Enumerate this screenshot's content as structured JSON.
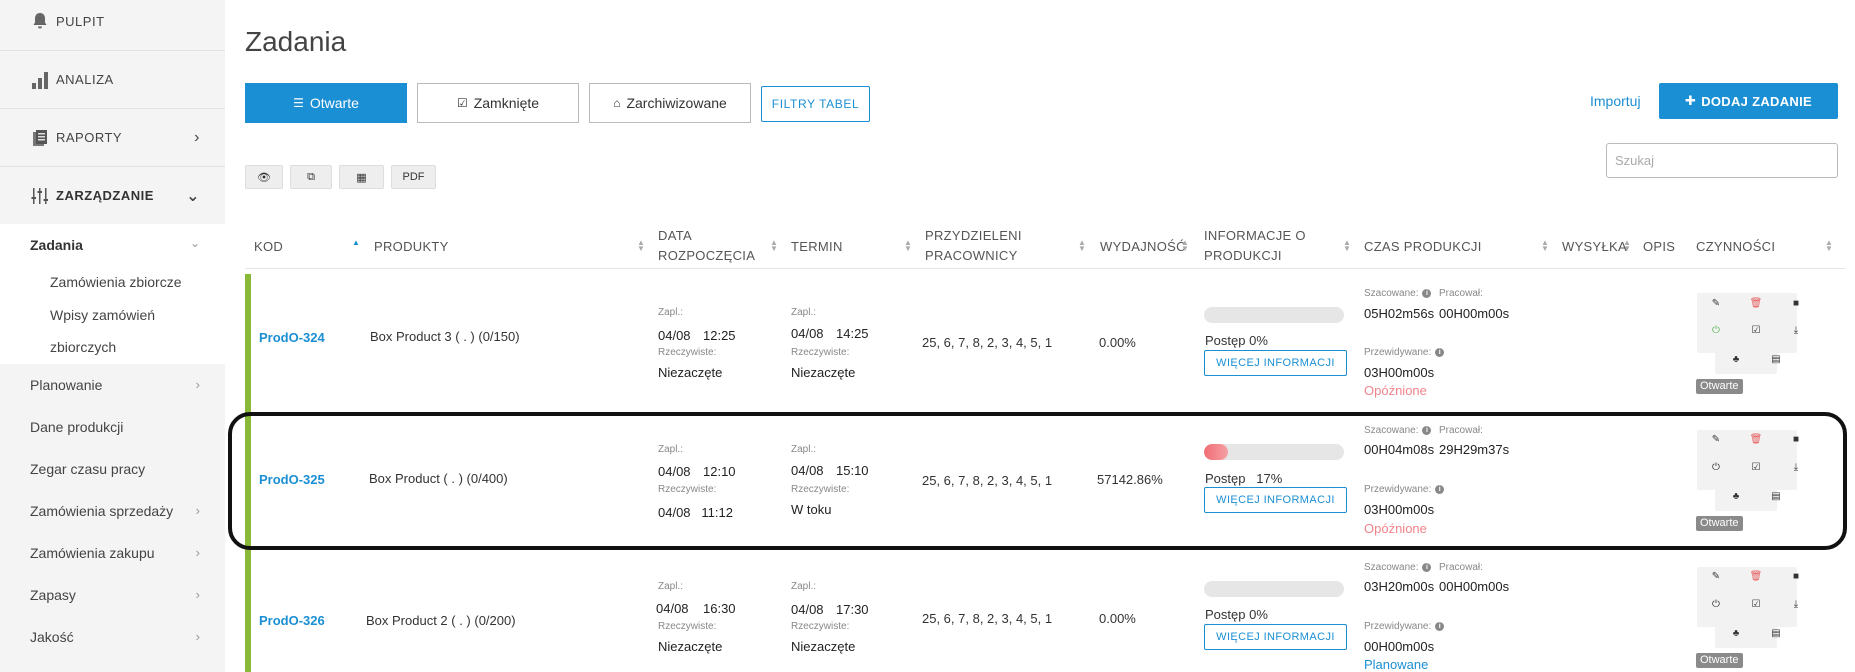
{
  "sidebar": {
    "pulpit": "PULPIT",
    "analiza": "ANALIZA",
    "raporty": "RAPORTY",
    "zarzadzanie": "ZARZĄDZANIE",
    "zadania": "Zadania",
    "sub_items": [
      "Zamówienia zbiorcze",
      "Wpisy zamówień",
      "zbiorczych"
    ],
    "items": [
      "Planowanie",
      "Dane produkcji",
      "Zegar czasu pracy",
      "Zamówienia sprzedaży",
      "Zamówienia zakupu",
      "Zapasy",
      "Jakość"
    ]
  },
  "page": {
    "title": "Zadania"
  },
  "tabs": {
    "open": "Otwarte",
    "closed": "Zamknięte",
    "archived": "Zarchiwizowane"
  },
  "filters_label": "FILTRY TABEL",
  "import_label": "Importuj",
  "add_label": "DODAJ ZADANIE",
  "search": {
    "placeholder": "Szukaj"
  },
  "toolbar": {
    "pdf": "PDF"
  },
  "columns": {
    "kod": "KOD",
    "produkty": "PRODUKTY",
    "data1": "DATA",
    "data2": "ROZPOCZĘCIA",
    "termin": "TERMIN",
    "prac1": "PRZYDZIELENI",
    "prac2": "PRACOWNICY",
    "wydajnosc": "WYDAJNOŚĆ",
    "info1": "INFORMACJE O",
    "info2": "PRODUKCJI",
    "czas": "CZAS PRODUKCJI",
    "wysylka": "WYSYŁKA",
    "opis": "OPIS",
    "czynnosci": "CZYNNOŚCI"
  },
  "labels": {
    "zapl": "Zapl.:",
    "rzecz": "Rzeczywiste:",
    "postep": "Postęp",
    "more": "WIĘCEJ INFORMACJI",
    "szacowane": "Szacowane:",
    "pracowal": "Pracował:",
    "przewidywane": "Przewidywane:",
    "badge": "Otwarte"
  },
  "rows": [
    {
      "code": "ProdO-324",
      "product": "Box Product 3 ( . ) (0/150)",
      "start_planned_date": "04/08",
      "start_planned_time": "12:25",
      "start_actual": "Niezaczęte",
      "due_planned_date": "04/08",
      "due_planned_time": "14:25",
      "due_actual": "Niezaczęte",
      "workers": "25, 6, 7, 8, 2, 3, 4, 5, 1",
      "efficiency": "0.00%",
      "progress_text": "Postęp 0%",
      "progress": 0,
      "estimated": "05H02m56s",
      "worked": "00H00m00s",
      "predicted": "03H00m00s",
      "status": "Opóźnione",
      "status_color": "#f0848a",
      "power_color": "green"
    },
    {
      "code": "ProdO-325",
      "product": "Box Product ( . ) (0/400)",
      "start_planned_date": "04/08",
      "start_planned_time": "12:10",
      "start_actual": "04/08   11:12",
      "due_planned_date": "04/08",
      "due_planned_time": "15:10",
      "due_actual": "W toku",
      "workers": "25, 6, 7, 8, 2, 3, 4, 5, 1",
      "efficiency": "57142.86%",
      "progress_text": "Postęp   17%",
      "progress": 17,
      "estimated": "00H04m08s",
      "worked": "29H29m37s",
      "predicted": "03H00m00s",
      "status": "Opóźnione",
      "status_color": "#f0848a",
      "power_color": "dark"
    },
    {
      "code": "ProdO-326",
      "product": "Box Product 2 ( . ) (0/200)",
      "start_planned_date": "04/08",
      "start_planned_time": "16:30",
      "start_actual": "Niezaczęte",
      "due_planned_date": "04/08",
      "due_planned_time": "17:30",
      "due_actual": "Niezaczęte",
      "workers": "25, 6, 7, 8, 2, 3, 4, 5, 1",
      "efficiency": "0.00%",
      "progress_text": "Postęp 0%",
      "progress": 0,
      "estimated": "03H20m00s",
      "worked": "00H00m00s",
      "predicted": "00H00m00s",
      "status": "Planowane",
      "status_color": "#1b8fd3",
      "power_color": "dark"
    }
  ]
}
